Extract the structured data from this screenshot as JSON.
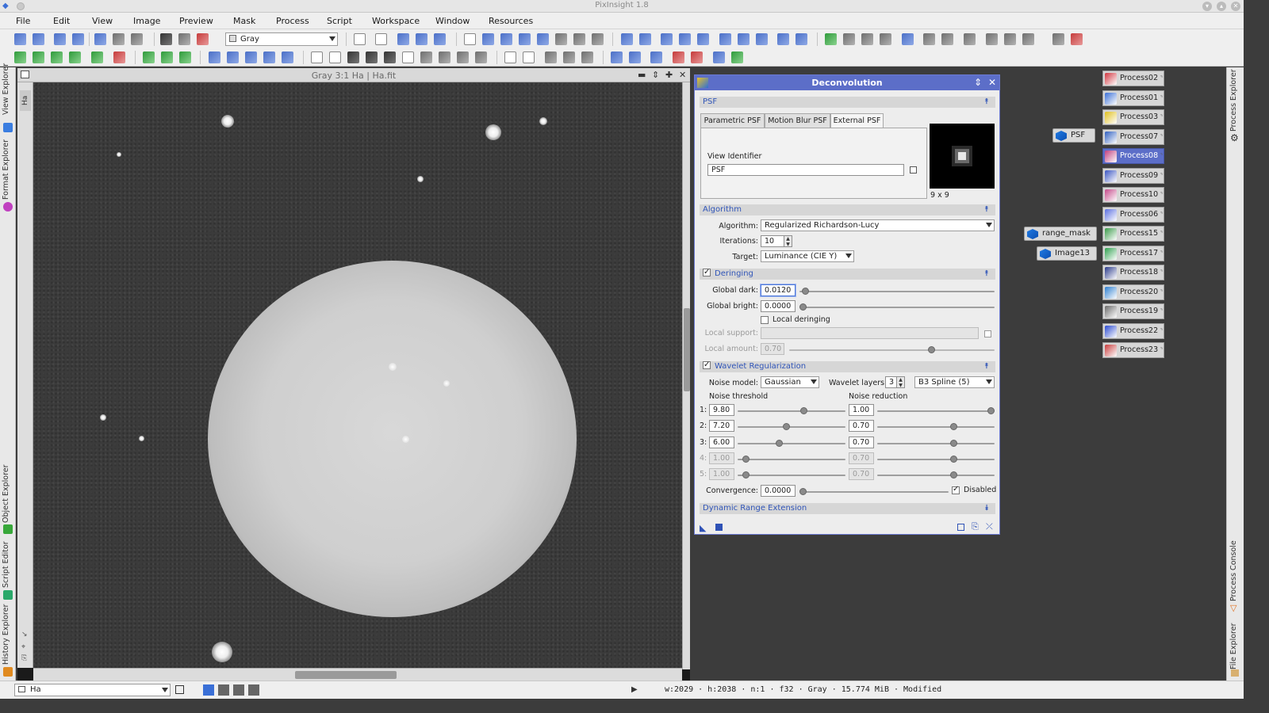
{
  "window": {
    "title": "PixInsight 1.8"
  },
  "menu": [
    "File",
    "Edit",
    "View",
    "Image",
    "Preview",
    "Mask",
    "Process",
    "Script",
    "Workspace",
    "Window",
    "Resources"
  ],
  "toolbar": {
    "colorspace_value": "Gray"
  },
  "left_tabs": [
    "View Explorer",
    "Format Explorer",
    "Object Explorer",
    "Script Editor",
    "History Explorer"
  ],
  "right_tabs": [
    "Process Explorer",
    "Process Console",
    "File Explorer"
  ],
  "image_window": {
    "title": "Gray 3:1 Ha | Ha.fit",
    "side_label": "Ha"
  },
  "deconvolution": {
    "title": "Deconvolution",
    "psf_section": "PSF",
    "psf_tabs": [
      "Parametric PSF",
      "Motion Blur PSF",
      "External PSF"
    ],
    "active_psf_tab": "External PSF",
    "view_identifier_label": "View Identifier",
    "view_identifier_value": "PSF",
    "psf_size": "9 x 9",
    "algorithm_section": "Algorithm",
    "algorithm_label": "Algorithm:",
    "algorithm_value": "Regularized Richardson-Lucy",
    "iterations_label": "Iterations:",
    "iterations_value": "10",
    "target_label": "Target:",
    "target_value": "Luminance (CIE Y)",
    "deringing_section": "Deringing",
    "deringing_enabled": true,
    "global_dark_label": "Global dark:",
    "global_dark_value": "0.0120",
    "global_dark_level": 0.012,
    "global_bright_label": "Global bright:",
    "global_bright_value": "0.0000",
    "global_bright_level": 0.0,
    "local_deringing_label": "Local deringing",
    "local_deringing_enabled": false,
    "local_support_label": "Local support:",
    "local_amount_label": "Local amount:",
    "local_amount_value": "0.70",
    "local_amount_level": 0.7,
    "wavelet_section": "Wavelet Regularization",
    "wavelet_enabled": true,
    "noise_model_label": "Noise model:",
    "noise_model_value": "Gaussian",
    "wavelet_layers_label": "Wavelet layers:",
    "wavelet_layers_value": "3",
    "scaling_function_value": "B3 Spline (5)",
    "noise_threshold_label": "Noise threshold",
    "noise_reduction_label": "Noise reduction",
    "layers": [
      {
        "index": "1:",
        "threshold": "9.80",
        "threshold_level": 0.62,
        "reduction": "1.00",
        "reduction_level": 1.0,
        "enabled": true
      },
      {
        "index": "2:",
        "threshold": "7.20",
        "threshold_level": 0.45,
        "reduction": "0.70",
        "reduction_level": 0.66,
        "enabled": true
      },
      {
        "index": "3:",
        "threshold": "6.00",
        "threshold_level": 0.38,
        "reduction": "0.70",
        "reduction_level": 0.66,
        "enabled": true
      },
      {
        "index": "4:",
        "threshold": "1.00",
        "threshold_level": 0.05,
        "reduction": "0.70",
        "reduction_level": 0.66,
        "enabled": false
      },
      {
        "index": "5:",
        "threshold": "1.00",
        "threshold_level": 0.05,
        "reduction": "0.70",
        "reduction_level": 0.66,
        "enabled": false
      }
    ],
    "convergence_label": "Convergence:",
    "convergence_value": "0.0000",
    "convergence_level": 0.0,
    "disabled_label": "Disabled",
    "convergence_disabled": true,
    "dre_section": "Dynamic Range Extension"
  },
  "workspace_icons": [
    {
      "label": "PSF"
    },
    {
      "label": "range_mask"
    },
    {
      "label": "Image13"
    }
  ],
  "process_icons": [
    {
      "label": "Process02",
      "color": "#d0363f"
    },
    {
      "label": "Process01",
      "color": "#3b6fd6"
    },
    {
      "label": "Process03",
      "color": "#e0c020"
    },
    {
      "label": "Process07",
      "color": "#2f5fc0"
    },
    {
      "label": "Process08",
      "color": "#c04080",
      "selected": true
    },
    {
      "label": "Process09",
      "color": "#3a55c2"
    },
    {
      "label": "Process10",
      "color": "#c44a8a"
    },
    {
      "label": "Process06",
      "color": "#5a6ee0"
    },
    {
      "label": "Process15",
      "color": "#3a9a4a"
    },
    {
      "label": "Process17",
      "color": "#30a050"
    },
    {
      "label": "Process18",
      "color": "#2a3a8a"
    },
    {
      "label": "Process20",
      "color": "#2f7fd0"
    },
    {
      "label": "Process19",
      "color": "#6a6a6a"
    },
    {
      "label": "Process22",
      "color": "#2a4ad0"
    },
    {
      "label": "Process23",
      "color": "#c83c3c"
    }
  ],
  "statusbar": {
    "view_selector": "Ha",
    "info": "w:2029 · h:2038 · n:1 · f32 · Gray · 15.774 MiB · Modified"
  }
}
